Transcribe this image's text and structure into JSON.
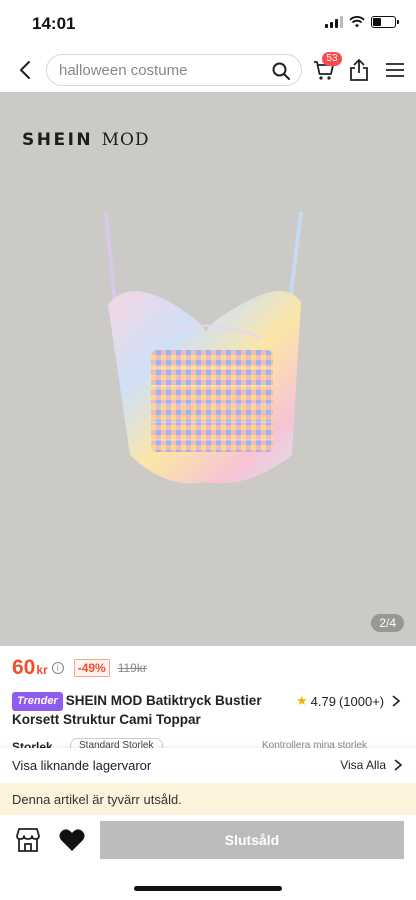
{
  "status_bar": {
    "time": "14:01"
  },
  "header": {
    "search_placeholder": "halloween costume",
    "cart_count": "53",
    "icons": [
      "back-icon",
      "search-icon",
      "cart-icon",
      "share-icon",
      "more-icon"
    ]
  },
  "product_image": {
    "brand_part1": "SHEIN",
    "brand_part2": "MOD",
    "counter": "2/4"
  },
  "price": {
    "current": "60",
    "currency": "kr",
    "info": "i",
    "discount": "-49%",
    "original": "119kr"
  },
  "product": {
    "badge": "Trender",
    "title": "SHEIN MOD Batiktryck Bustier Korsett Struktur Cami Toppar",
    "rating_value": "4.79",
    "rating_count": "(1000+)"
  },
  "size": {
    "label": "Storlek",
    "option": "Standard Storlek",
    "guide": "Kontrollera mina storlek"
  },
  "similar": {
    "title": "Visa liknande lagervaror",
    "link": "Visa Alla"
  },
  "notice": {
    "text": "Denna artikel är tyvärr utsåld."
  },
  "bottom_bar": {
    "soldout_label": "Slutsåld"
  },
  "colors": {
    "accent": "#f34d2a",
    "badge": "#fa4b4b",
    "trender": "#8f5cf0",
    "notice_bg": "#fdf2dc",
    "button_disabled": "#bbbbbb",
    "star": "#f8b100"
  }
}
